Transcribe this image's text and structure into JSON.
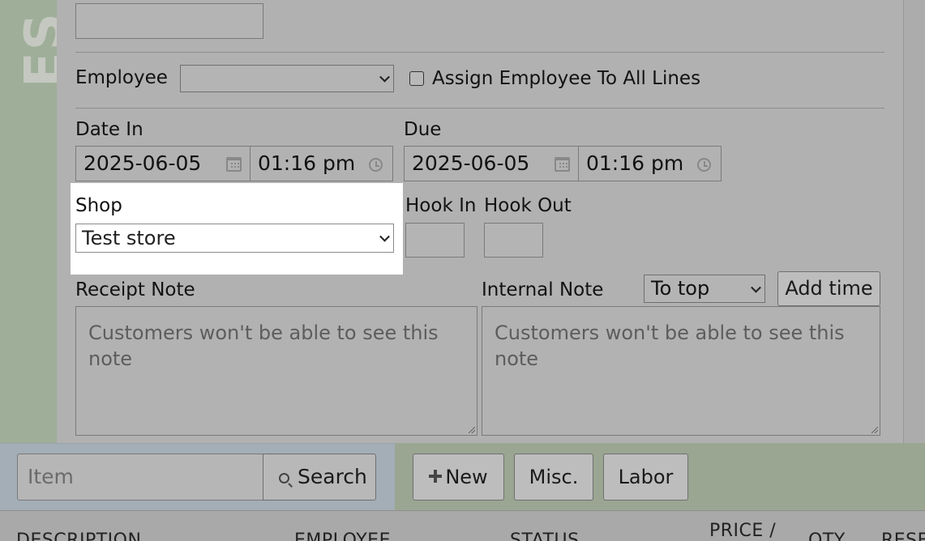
{
  "sidebar": {
    "vertical_text": "ES"
  },
  "employee": {
    "label": "Employee",
    "selected": "",
    "assign_all_label": "Assign Employee To All Lines"
  },
  "date_in": {
    "label": "Date In",
    "date": "2025-06-05",
    "time": "01:16 pm"
  },
  "due": {
    "label": "Due",
    "date": "2025-06-05",
    "time": "01:16 pm"
  },
  "shop": {
    "label": "Shop",
    "selected": "Test store"
  },
  "hook_in": {
    "label": "Hook In",
    "value": ""
  },
  "hook_out": {
    "label": "Hook Out",
    "value": ""
  },
  "receipt_note": {
    "label": "Receipt Note",
    "placeholder": "Customers won't be able to see this note"
  },
  "internal_note": {
    "label": "Internal Note",
    "placeholder": "Customers won't be able to see this note",
    "position_selected": "To top",
    "add_time_label": "Add time"
  },
  "toolbar": {
    "item_placeholder": "Item",
    "search_label": "Search",
    "new_label": "New",
    "misc_label": "Misc.",
    "labor_label": "Labor"
  },
  "table": {
    "columns": [
      "DESCRIPTION",
      "EMPLOYEE",
      "STATUS",
      "PRICE /",
      "QTY",
      "RESE"
    ]
  }
}
